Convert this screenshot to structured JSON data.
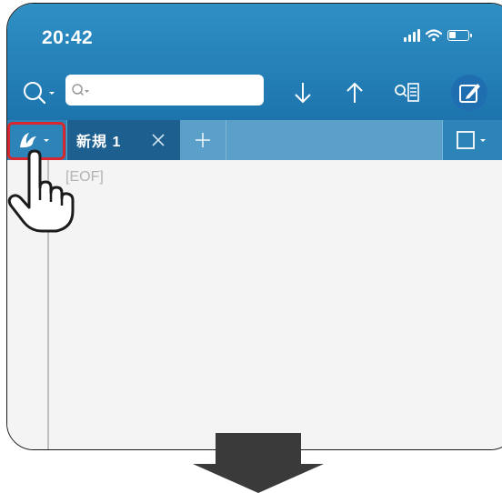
{
  "status_bar": {
    "time": "20:42"
  },
  "search": {
    "value": "",
    "placeholder": ""
  },
  "tabs": {
    "active_label": "新規 1",
    "close_symbol": "×",
    "add_symbol": "+"
  },
  "editor": {
    "eof_marker": "[EOF]"
  },
  "icons": {
    "search": "search-icon",
    "search_options": "search-options-icon",
    "next": "arrow-down-icon",
    "prev": "arrow-up-icon",
    "find_list": "find-list-icon",
    "edit": "edit-icon",
    "language": "language-mode-icon",
    "window": "window-icon",
    "hand": "hand-pointer-icon",
    "big_arrow": "big-down-arrow-icon"
  },
  "colors": {
    "toolbar": "#2f90c4",
    "active_tab": "#1d5f8f",
    "highlight": "#d7282f",
    "edit_button": "#1f6fb0"
  }
}
